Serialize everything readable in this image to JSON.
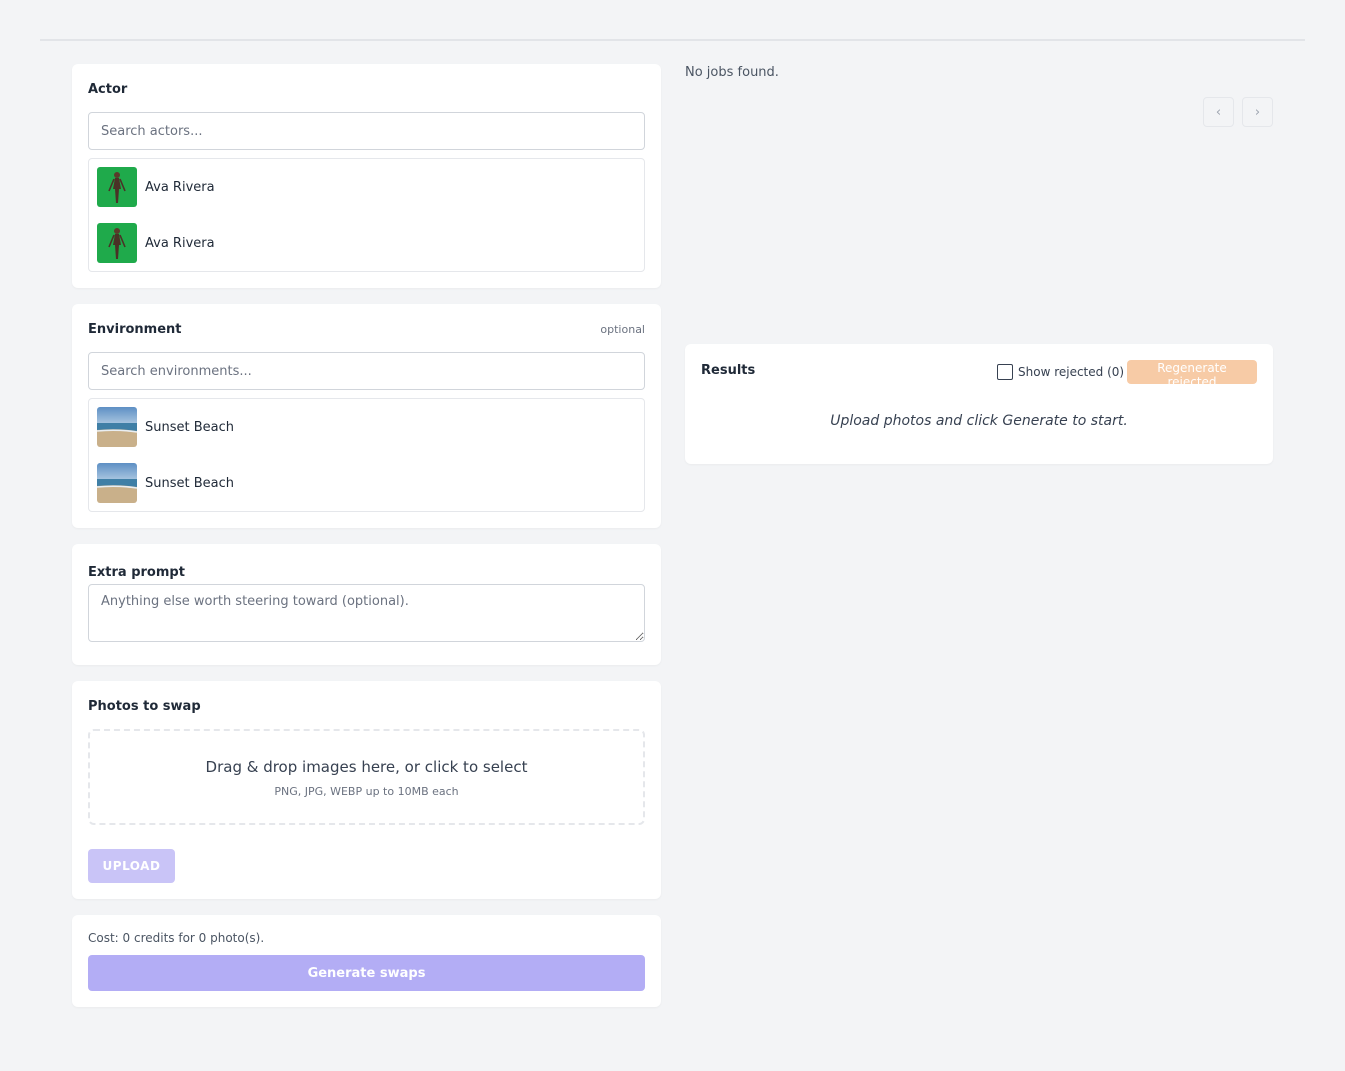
{
  "actor": {
    "title": "Actor",
    "search_placeholder": "Search actors...",
    "items": [
      {
        "label": "Ava Rivera",
        "icon": "actor-thumbnail"
      },
      {
        "label": "Ava Rivera",
        "icon": "actor-thumbnail"
      }
    ]
  },
  "environment": {
    "title": "Environment",
    "optional_label": "optional",
    "search_placeholder": "Search environments...",
    "items": [
      {
        "label": "Sunset Beach",
        "icon": "beach-thumbnail"
      },
      {
        "label": "Sunset Beach",
        "icon": "beach-thumbnail"
      }
    ]
  },
  "extra_prompt": {
    "title": "Extra prompt",
    "placeholder": "Anything else worth steering toward (optional)."
  },
  "photos": {
    "title": "Photos to swap",
    "drop_text": "Drag & drop images here, or click to select",
    "drop_hint": "PNG, JPG, WEBP up to 10MB each",
    "upload_label": "UPLOAD"
  },
  "generate": {
    "cost_text": "Cost: 0 credits for 0 photo(s).",
    "button_label": "Generate swaps"
  },
  "jobs": {
    "empty_text": "No jobs found.",
    "prev_label": "‹",
    "next_label": "›"
  },
  "results": {
    "title": "Results",
    "show_rejected_label": "Show rejected (0)",
    "show_rejected_checked": false,
    "regenerate_label": "Regenerate rejected",
    "empty_message": "Upload photos and click Generate to start."
  },
  "colors": {
    "background": "#f3f4f6",
    "primary_disabled": "#b3adf5",
    "warning_disabled": "#f7cba6",
    "actor_backdrop": "#1faa4b"
  }
}
